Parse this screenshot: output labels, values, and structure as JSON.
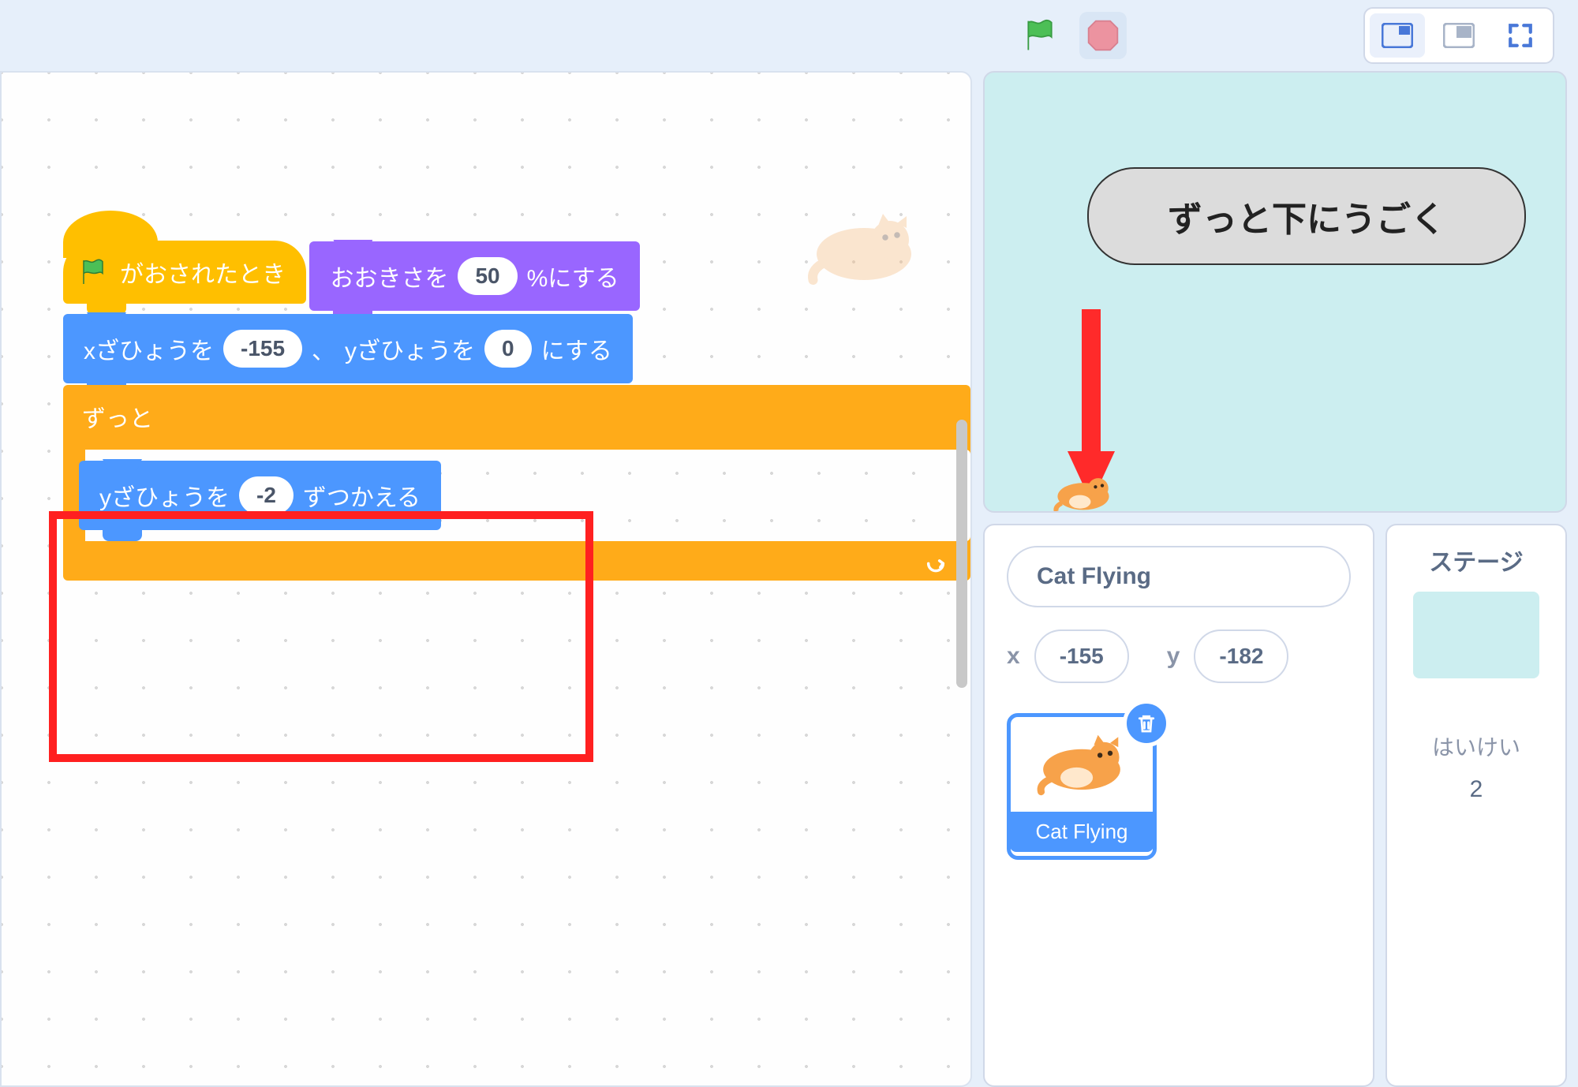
{
  "blocks": {
    "hat_label": "がおされたとき",
    "set_size_prefix": "おおきさを",
    "set_size_value": "50",
    "set_size_suffix": "%にする",
    "goto_x_prefix": "xざひょうを",
    "goto_x_value": "-155",
    "goto_sep": "、",
    "goto_y_prefix": "yざひょうを",
    "goto_y_value": "0",
    "goto_suffix": "にする",
    "forever_label": "ずっと",
    "change_y_prefix": "yざひょうを",
    "change_y_value": "-2",
    "change_y_suffix": "ずつかえる"
  },
  "stage": {
    "bubble_text": "ずっと下にうごく"
  },
  "sprite": {
    "name": "Cat Flying",
    "x_label": "x",
    "x_value": "-155",
    "y_label": "y",
    "y_value": "-182",
    "thumb_label": "Cat Flying"
  },
  "stage_panel": {
    "title": "ステージ",
    "backdrops_label": "はいけい",
    "backdrops_count": "2"
  }
}
